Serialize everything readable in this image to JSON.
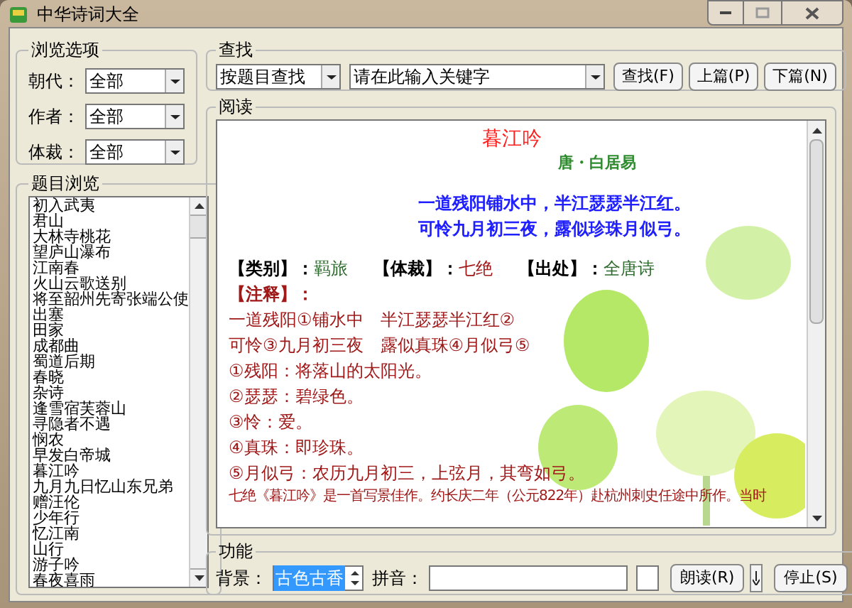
{
  "window": {
    "title": "中华诗词大全"
  },
  "browse_options": {
    "title": "浏览选项",
    "fields": [
      {
        "label": "朝代：",
        "value": "全部"
      },
      {
        "label": "作者：",
        "value": "全部"
      },
      {
        "label": "体裁：",
        "value": "全部"
      }
    ]
  },
  "title_browse": {
    "title": "题目浏览",
    "items": [
      "初入武夷",
      "君山",
      "大林寺桃花",
      "望庐山瀑布",
      "江南春",
      "火山云歌送别",
      "将至韶州先寄张端公使",
      "出塞",
      "田家",
      "成都曲",
      "蜀道后期",
      "春晓",
      "杂诗",
      "逢雪宿芙蓉山",
      "寻隐者不遇",
      "悯农",
      "早发白帝城",
      "暮江吟",
      "九月九日忆山东兄弟",
      "赠汪伦",
      "少年行",
      "忆江南",
      "山行",
      "游子吟",
      "春夜喜雨"
    ]
  },
  "search": {
    "title": "查找",
    "mode": "按题目查找",
    "keyword": "请在此输入关键字",
    "buttons": [
      "查找(F)",
      "上篇(P)",
      "下篇(N)"
    ]
  },
  "reading": {
    "title": "阅读",
    "poem_title": "暮江吟",
    "author": "唐・白居易",
    "lines": [
      "一道残阳铺水中，半江瑟瑟半江红。",
      "可怜九月初三夜，露似珍珠月似弓。"
    ],
    "meta": [
      {
        "label": "【类别】：",
        "value": "羁旅",
        "color": "#2e6b2e"
      },
      {
        "label": "【体裁】：",
        "value": "七绝",
        "color": "#a01818"
      },
      {
        "label": "【出处】：",
        "value": "全唐诗",
        "color": "#2e6b2e"
      }
    ],
    "notes_heading": "【注释】：",
    "annotated_lines": [
      "一道残阳①铺水中　半江瑟瑟半江红②",
      "可怜③九月初三夜　露似真珠④月似弓⑤"
    ],
    "notes": [
      "①残阳：将落山的太阳光。",
      "②瑟瑟：碧绿色。",
      "③怜：爱。",
      "④真珠：即珍珠。",
      "⑤月似弓：农历九月初三，上弦月，其弯如弓。"
    ],
    "commentary": "七绝《暮江吟》是一首写景佳作。约长庆二年（公元822年）赴杭州刺史任途中所作。当时"
  },
  "function": {
    "title": "功能",
    "background_label": "背景：",
    "background_value": "古色古香",
    "background_selected": true,
    "pinyin_label": "拼音：",
    "buttons": [
      "朗读(R)",
      "停止(S)"
    ]
  }
}
